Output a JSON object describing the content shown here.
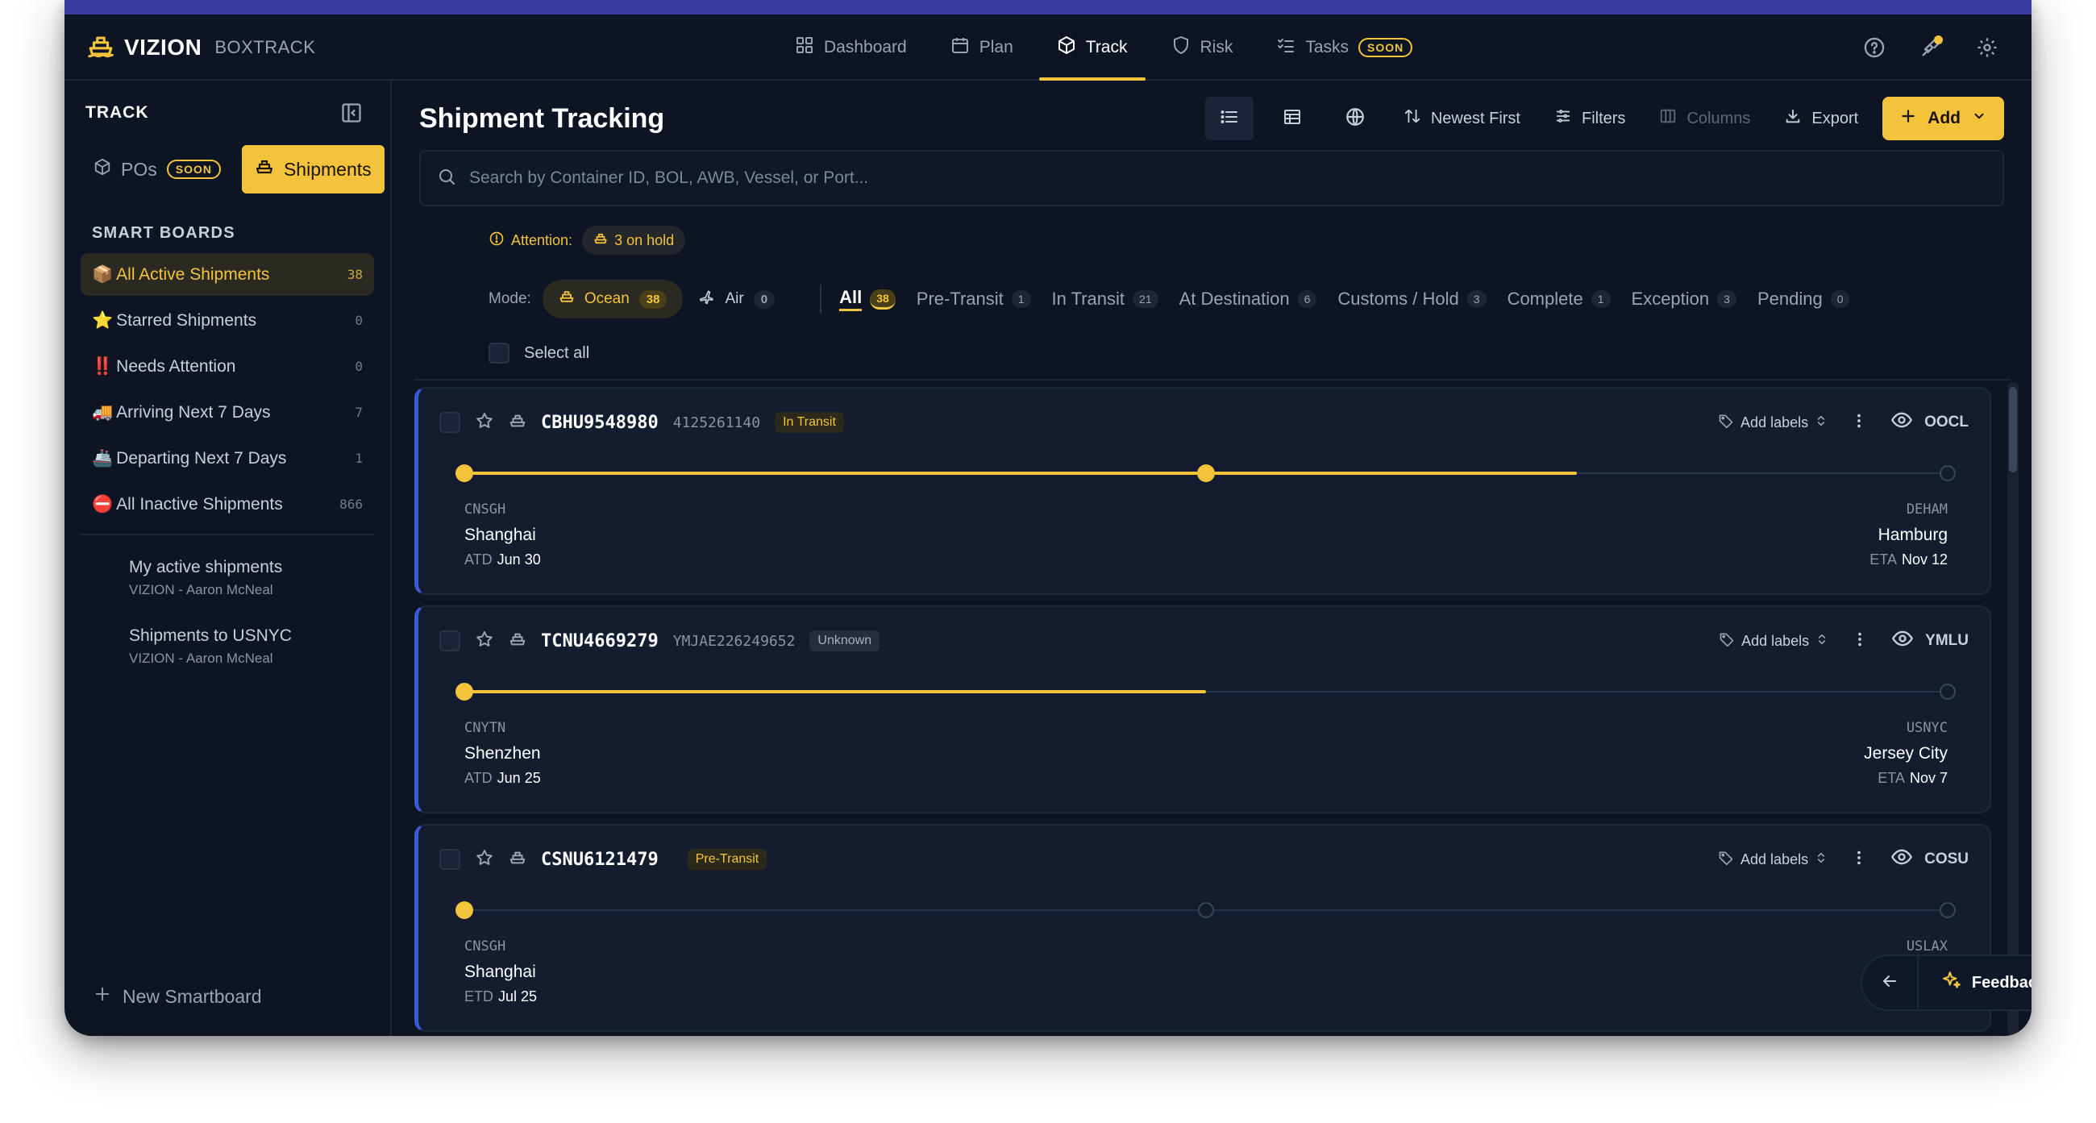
{
  "brand": {
    "name": "VIZION",
    "sub": "BOXTRACK"
  },
  "nav": [
    {
      "label": "Dashboard",
      "icon": "dashboard-icon"
    },
    {
      "label": "Plan",
      "icon": "calendar-icon"
    },
    {
      "label": "Track",
      "icon": "box-icon",
      "active": true
    },
    {
      "label": "Risk",
      "icon": "shield-icon"
    },
    {
      "label": "Tasks",
      "icon": "checklist-icon",
      "badge": "SOON"
    }
  ],
  "sidebar": {
    "title": "TRACK",
    "pos_label": "POs",
    "pos_badge": "SOON",
    "shipments_label": "Shipments",
    "section": "SMART BOARDS",
    "boards": [
      {
        "emoji": "📦",
        "label": "All Active Shipments",
        "count": "38"
      },
      {
        "emoji": "⭐",
        "label": "Starred Shipments",
        "count": "0"
      },
      {
        "emoji": "‼️",
        "label": "Needs Attention",
        "count": "0"
      },
      {
        "emoji": "🚚",
        "label": "Arriving Next 7 Days",
        "count": "7"
      },
      {
        "emoji": "🚢",
        "label": "Departing Next 7 Days",
        "count": "1"
      },
      {
        "emoji": "⛔",
        "label": "All Inactive Shipments",
        "count": "866"
      }
    ],
    "saved": [
      {
        "title": "My active shipments",
        "owner": "VIZION - Aaron McNeal"
      },
      {
        "title": "Shipments to USNYC",
        "owner": "VIZION - Aaron McNeal"
      }
    ],
    "new_board": "New Smartboard"
  },
  "main": {
    "title": "Shipment Tracking",
    "sort_label": "Newest First",
    "filters_label": "Filters",
    "columns_label": "Columns",
    "export_label": "Export",
    "add_label": "Add",
    "search_placeholder": "Search by Container ID, BOL, AWB, Vessel, or Port...",
    "attention_label": "Attention:",
    "hold_label": "3 on hold",
    "mode_label": "Mode:",
    "modes": [
      {
        "label": "Ocean",
        "count": "38"
      },
      {
        "label": "Air",
        "count": "0"
      }
    ],
    "tabs": [
      {
        "label": "All",
        "count": "38"
      },
      {
        "label": "Pre-Transit",
        "count": "1"
      },
      {
        "label": "In Transit",
        "count": "21"
      },
      {
        "label": "At Destination",
        "count": "6"
      },
      {
        "label": "Customs / Hold",
        "count": "3"
      },
      {
        "label": "Complete",
        "count": "1"
      },
      {
        "label": "Exception",
        "count": "3"
      },
      {
        "label": "Pending",
        "count": "0"
      }
    ],
    "select_all": "Select all"
  },
  "shipments": [
    {
      "id": "CBHU9548980",
      "ref": "4125261140",
      "status": "In Transit",
      "status_kind": "transit",
      "labels": "Add labels",
      "carrier": "OOCL",
      "progress": 0.75,
      "mid_reached": true,
      "origin": {
        "code": "CNSGH",
        "city": "Shanghai",
        "date_key": "ATD",
        "date": "Jun 30"
      },
      "dest": {
        "code": "DEHAM",
        "city": "Hamburg",
        "date_key": "ETA",
        "date": "Nov 12"
      }
    },
    {
      "id": "TCNU4669279",
      "ref": "YMJAE226249652",
      "status": "Unknown",
      "status_kind": "unknown",
      "labels": "Add labels",
      "carrier": "YMLU",
      "progress": 0.5,
      "mid_reached": false,
      "mid_hidden": true,
      "origin": {
        "code": "CNYTN",
        "city": "Shenzhen",
        "date_key": "ATD",
        "date": "Jun 25"
      },
      "dest": {
        "code": "USNYC",
        "city": "Jersey City",
        "date_key": "ETA",
        "date": "Nov 7"
      }
    },
    {
      "id": "CSNU6121479",
      "ref": "",
      "status": "Pre-Transit",
      "status_kind": "pretransit",
      "labels": "Add labels",
      "carrier": "COSU",
      "progress": 0.0,
      "mid_reached": false,
      "origin": {
        "code": "CNSGH",
        "city": "Shanghai",
        "date_key": "ETD",
        "date": "Jul 25"
      },
      "dest": {
        "code": "USLAX",
        "city": "",
        "date_key": "",
        "date": ""
      }
    }
  ],
  "feedback": {
    "label": "Feedback"
  },
  "colors": {
    "accent": "#f3c33c",
    "bg": "#0d1525",
    "card": "#141d2f",
    "card_edge": "#3b5bd6"
  }
}
